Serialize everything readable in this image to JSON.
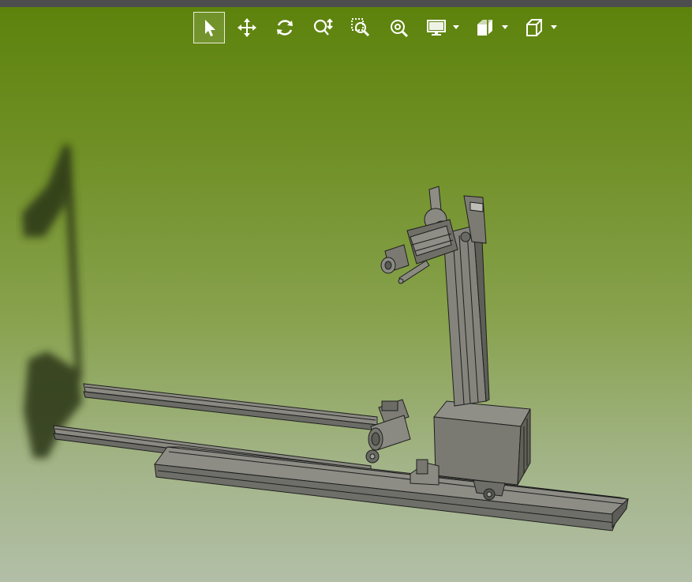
{
  "window": {
    "title": ""
  },
  "toolbar": {
    "buttons": [
      {
        "id": "select",
        "icon": "select-arrow-icon",
        "active": true
      },
      {
        "id": "pan",
        "icon": "pan-move-icon"
      },
      {
        "id": "rotate",
        "icon": "rotate-icon"
      },
      {
        "id": "zoom",
        "icon": "zoom-updown-icon"
      },
      {
        "id": "zoom-window",
        "icon": "zoom-window-icon"
      },
      {
        "id": "zoom-fit",
        "icon": "zoom-fit-icon"
      },
      {
        "id": "display-mode",
        "icon": "monitor-icon",
        "dropdown": true
      },
      {
        "id": "section",
        "icon": "section-cube-icon",
        "dropdown": true
      },
      {
        "id": "view-orientation",
        "icon": "view-cube-icon",
        "dropdown": true
      }
    ],
    "icon_color": "#ffffff"
  },
  "viewport": {
    "background_top": "#5c820b",
    "background_bottom": "#b2bfa7",
    "model_fill": "#7a7a72",
    "model_stroke": "#1e1e1e"
  }
}
